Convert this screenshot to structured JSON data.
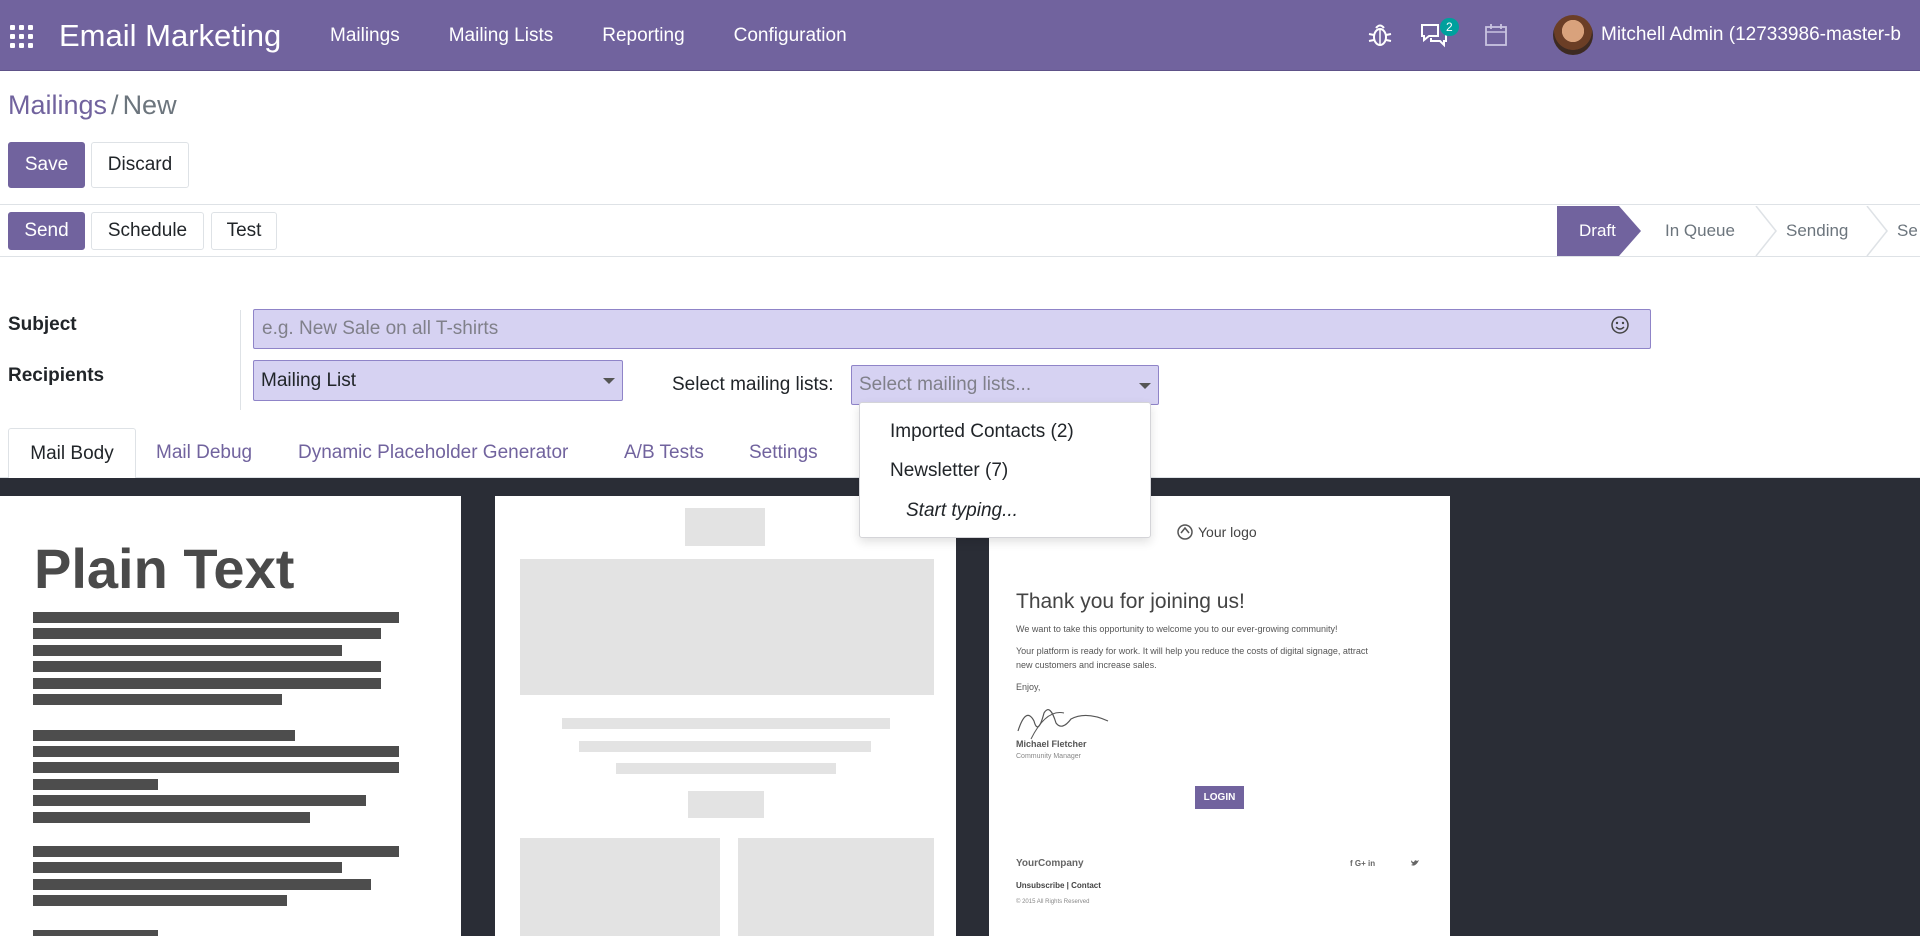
{
  "app": {
    "title": "Email Marketing"
  },
  "nav": {
    "menu": [
      "Mailings",
      "Mailing Lists",
      "Reporting",
      "Configuration"
    ],
    "messages_badge": "2",
    "user_name": "Mitchell Admin (12733986-master-b",
    "icons": [
      "apps-grid-icon",
      "bug-icon",
      "chat-icon",
      "calendar-icon"
    ]
  },
  "breadcrumb": {
    "parent": "Mailings",
    "separator": "/",
    "current": "New"
  },
  "control_panel": {
    "save": "Save",
    "discard": "Discard"
  },
  "header_buttons": {
    "send": "Send",
    "schedule": "Schedule",
    "test": "Test"
  },
  "statusbar": {
    "stages": [
      "Draft",
      "In Queue",
      "Sending",
      "Se"
    ],
    "active": "Draft"
  },
  "form": {
    "subject_label": "Subject",
    "subject_placeholder": "e.g. New Sale on all T-shirts",
    "recipients_label": "Recipients",
    "recipients_value": "Mailing List",
    "mailing_lists_label": "Select mailing lists:",
    "mailing_lists_placeholder": "Select mailing lists..."
  },
  "dropdown": {
    "items": [
      "Imported Contacts (2)",
      "Newsletter (7)"
    ],
    "hint": "Start typing..."
  },
  "tabs": [
    "Mail Body",
    "Mail Debug",
    "Dynamic Placeholder Generator",
    "A/B Tests",
    "Settings"
  ],
  "templates": {
    "plain_text": {
      "title": "Plain Text"
    },
    "welcome": {
      "logo": "Your logo",
      "heading": "Thank you for joining us!",
      "line1": "We want to take this opportunity to welcome you to our ever-growing community!",
      "line2a": "Your platform is ready for work. It will help you reduce the costs of digital signage, attract",
      "line2b": "new customers and increase sales.",
      "enjoy": "Enjoy,",
      "signer": "Michael Fletcher",
      "signer_title": "Community Manager",
      "login": "LOGIN",
      "company": "YourCompany",
      "links": "Unsubscribe | Contact",
      "copyright": "© 2015 All Rights Reserved",
      "social": "f   G+   in"
    }
  },
  "colors": {
    "brand": "#71639e",
    "input_bg": "#d6d2f2",
    "badge": "#00a09d",
    "template_bg": "#2a2d36"
  }
}
